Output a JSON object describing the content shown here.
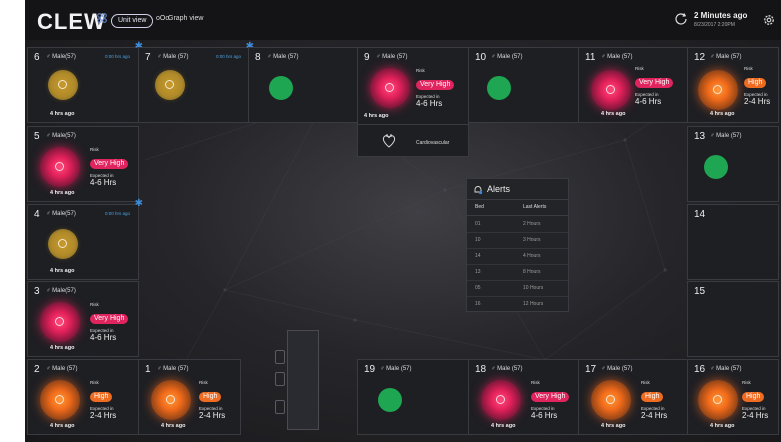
{
  "header": {
    "logo": "CLEW",
    "unit_view": "Unit view",
    "graph_view": "Graph view",
    "graph_icon_glyph": "oOo",
    "updated": "2 Minutes ago",
    "updated_date": "8/23/2017 2:20PM"
  },
  "beds": {
    "b6": {
      "num": "6",
      "gender": "♂ Male(57)",
      "timer": "0:00 hrs ago",
      "ago": "4 hrs ago"
    },
    "b7": {
      "num": "7",
      "gender": "♂ Male (57)",
      "timer": "0:00 hrs ago"
    },
    "b8": {
      "num": "8",
      "gender": "♂ Male (57)"
    },
    "b9": {
      "num": "9",
      "gender": "♂ Male (57)",
      "risk_label": "Risk",
      "risk": "Very High",
      "exp_label": "Expected in",
      "exp": "4-6 Hrs",
      "ago": "4 hrs ago",
      "condition": "Cardiovascular"
    },
    "b10": {
      "num": "10",
      "gender": "♂ Male (57)"
    },
    "b11": {
      "num": "11",
      "gender": "♂ Male (57)",
      "risk_label": "Risk",
      "risk": "Very High",
      "exp_label": "Expected in",
      "exp": "4-6 Hrs",
      "ago": "4 hrs ago"
    },
    "b12": {
      "num": "12",
      "gender": "♂ Male (57)",
      "risk_label": "Risk",
      "risk": "High",
      "exp_label": "Expected in",
      "exp": "2-4 Hrs",
      "ago": "4 hrs ago"
    },
    "b5": {
      "num": "5",
      "gender": "♂ Male(57)",
      "risk_label": "Risk",
      "risk": "Very High",
      "exp_label": "Expected in",
      "exp": "4-6 Hrs",
      "ago": "4 hrs ago"
    },
    "b13": {
      "num": "13",
      "gender": "♂ Male (57)"
    },
    "b4": {
      "num": "4",
      "gender": "♂ Male(57)",
      "timer": "0:00 hrs ago",
      "ago": "4 hrs ago"
    },
    "b14": {
      "num": "14"
    },
    "b3": {
      "num": "3",
      "gender": "♂ Male(57)",
      "risk_label": "Risk",
      "risk": "Very High",
      "exp_label": "Expected in",
      "exp": "4-6 Hrs",
      "ago": "4 hrs ago"
    },
    "b15": {
      "num": "15"
    },
    "b2": {
      "num": "2",
      "gender": "♂ Male (57)",
      "risk_label": "Risk",
      "risk": "High",
      "exp_label": "Expected in",
      "exp": "2-4 Hrs",
      "ago": "4 hrs ago"
    },
    "b1": {
      "num": "1",
      "gender": "♂ Male (57)",
      "risk_label": "Risk",
      "risk": "High",
      "exp_label": "Expected in",
      "exp": "2-4 Hrs",
      "ago": "4 hrs ago"
    },
    "b19": {
      "num": "19",
      "gender": "♂ Male (57)"
    },
    "b18": {
      "num": "18",
      "gender": "♂ Male (57)",
      "risk_label": "Risk",
      "risk": "Very High",
      "exp_label": "Expected in",
      "exp": "4-6 Hrs",
      "ago": "4 hrs ago"
    },
    "b17": {
      "num": "17",
      "gender": "♂ Male (57)",
      "risk_label": "Risk",
      "risk": "High",
      "exp_label": "Expected in",
      "exp": "2-4 Hrs",
      "ago": "4 hrs ago"
    },
    "b16": {
      "num": "16",
      "gender": "♂ Male (57)",
      "risk_label": "Risk",
      "risk": "High",
      "exp_label": "Expected in",
      "exp": "2-4 Hrs",
      "ago": "4 hrs ago"
    }
  },
  "alerts": {
    "title": "Alerts",
    "col_bed": "Bed",
    "col_last": "Last Alerts",
    "rows": [
      {
        "bed": "01",
        "last": "2 Hours"
      },
      {
        "bed": "10",
        "last": "3 Hours"
      },
      {
        "bed": "14",
        "last": "4 Hours"
      },
      {
        "bed": "13",
        "last": "8 Hours"
      },
      {
        "bed": "05",
        "last": "10 Hours"
      },
      {
        "bed": "16",
        "last": "12 Hours"
      }
    ]
  },
  "colors": {
    "very_high": "#e0245e",
    "high": "#ee6b22",
    "stable": "#1ea653",
    "watch": "#c89a2a",
    "accent": "#3d8bd9"
  }
}
